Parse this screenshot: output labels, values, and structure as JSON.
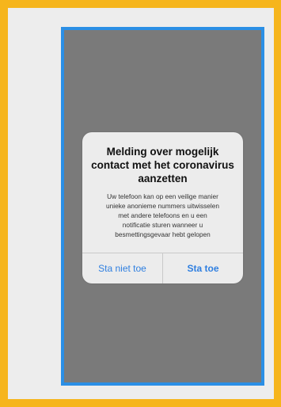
{
  "colors": {
    "frame_border": "#f6b51c",
    "phone_border": "#2b8fe5",
    "overlay_gray": "#7a7a7a",
    "dialog_bg": "#ececec",
    "button_blue": "#2f7fe0"
  },
  "dialog": {
    "title": "Melding over mogelijk\ncontact met het coronavirus\naanzetten",
    "body": "Uw telefoon kan op een veilige manier\nunieke anonieme nummers uitwisselen\nmet andere telefoons en u een\nnotificatie sturen wanneer u\nbesmettingsgevaar hebt gelopen",
    "buttons": {
      "deny": "Sta niet toe",
      "allow": "Sta toe"
    }
  }
}
